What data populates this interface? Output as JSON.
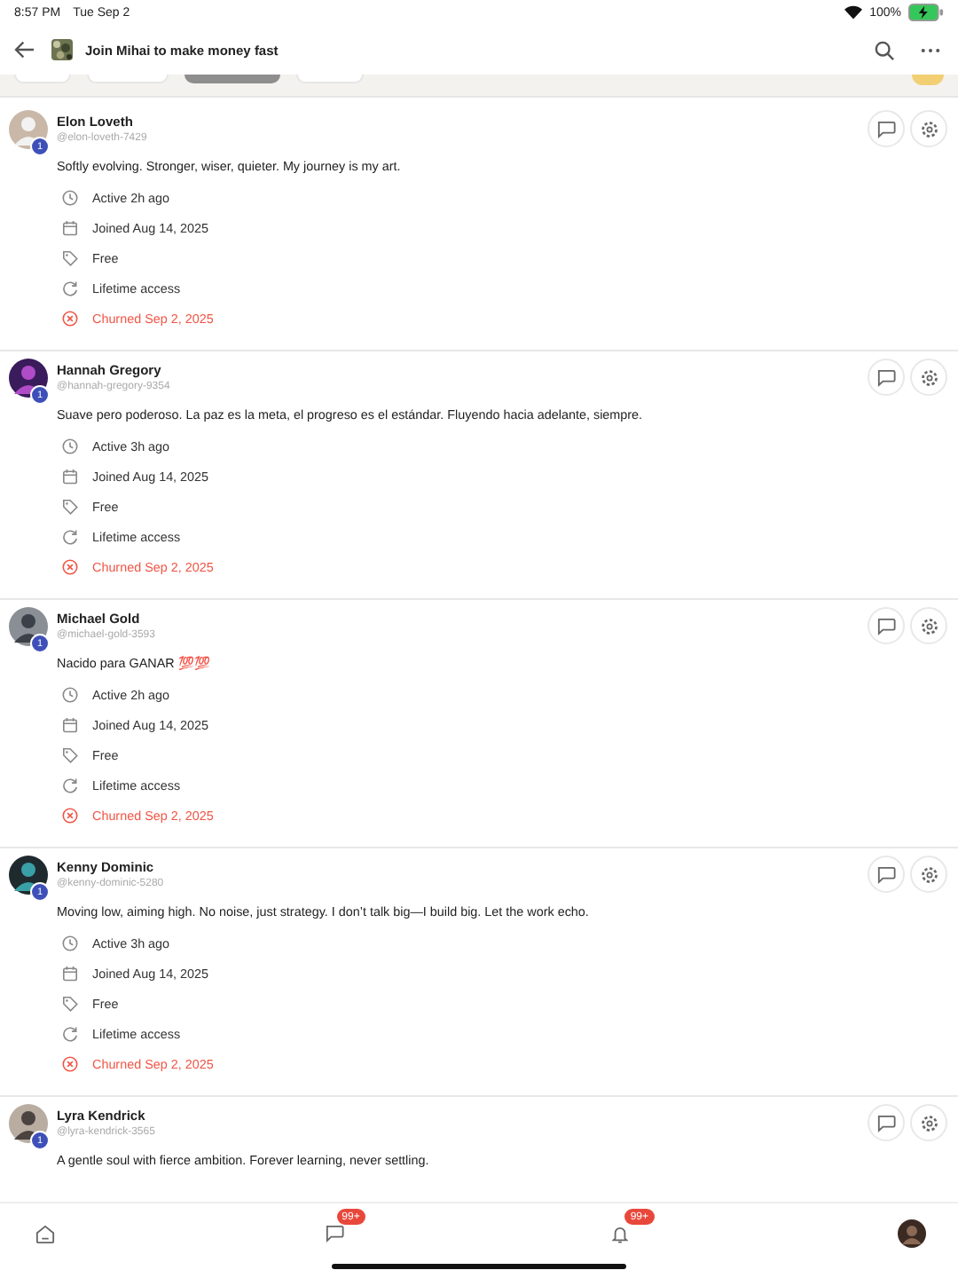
{
  "status_bar": {
    "time": "8:57 PM",
    "date": "Tue Sep 2",
    "battery": "100%"
  },
  "header": {
    "title": "Join Mihai to make money fast"
  },
  "filter_chips": [
    {
      "selected": false
    },
    {
      "selected": false
    },
    {
      "selected": true
    },
    {
      "selected": false
    }
  ],
  "members": [
    {
      "name": "Elon Loveth",
      "handle": "@elon-loveth-7429",
      "level": "1",
      "bio": "Softly evolving. Stronger, wiser, quieter. My journey is my art.",
      "details": [
        {
          "kind": "active",
          "text": "Active 2h ago"
        },
        {
          "kind": "joined",
          "text": "Joined Aug 14, 2025"
        },
        {
          "kind": "plan",
          "text": "Free"
        },
        {
          "kind": "access",
          "text": "Lifetime access"
        },
        {
          "kind": "churned",
          "text": "Churned Sep 2, 2025"
        }
      ]
    },
    {
      "name": "Hannah Gregory",
      "handle": "@hannah-gregory-9354",
      "level": "1",
      "bio": "Suave pero poderoso. La paz es la meta, el progreso es el estándar. Fluyendo hacia adelante, siempre.",
      "details": [
        {
          "kind": "active",
          "text": "Active 3h ago"
        },
        {
          "kind": "joined",
          "text": "Joined Aug 14, 2025"
        },
        {
          "kind": "plan",
          "text": "Free"
        },
        {
          "kind": "access",
          "text": "Lifetime access"
        },
        {
          "kind": "churned",
          "text": "Churned Sep 2, 2025"
        }
      ]
    },
    {
      "name": "Michael Gold",
      "handle": "@michael-gold-3593",
      "level": "1",
      "bio": "Nacido para GANAR 💯💯",
      "details": [
        {
          "kind": "active",
          "text": "Active 2h ago"
        },
        {
          "kind": "joined",
          "text": "Joined Aug 14, 2025"
        },
        {
          "kind": "plan",
          "text": "Free"
        },
        {
          "kind": "access",
          "text": "Lifetime access"
        },
        {
          "kind": "churned",
          "text": "Churned Sep 2, 2025"
        }
      ]
    },
    {
      "name": "Kenny Dominic",
      "handle": "@kenny-dominic-5280",
      "level": "1",
      "bio": "Moving low, aiming high. No noise, just strategy. I don’t talk big—I build big. Let the work echo.",
      "details": [
        {
          "kind": "active",
          "text": "Active 3h ago"
        },
        {
          "kind": "joined",
          "text": "Joined Aug 14, 2025"
        },
        {
          "kind": "plan",
          "text": "Free"
        },
        {
          "kind": "access",
          "text": "Lifetime access"
        },
        {
          "kind": "churned",
          "text": "Churned Sep 2, 2025"
        }
      ]
    },
    {
      "name": "Lyra Kendrick",
      "handle": "@lyra-kendrick-3565",
      "level": "1",
      "bio": "A gentle soul with fierce ambition. Forever learning, never settling."
    }
  ],
  "bottom_nav": [
    {
      "kind": "home"
    },
    {
      "kind": "chat",
      "badge": "99+"
    },
    {
      "kind": "bell",
      "badge": "99+"
    },
    {
      "kind": "profile"
    }
  ]
}
